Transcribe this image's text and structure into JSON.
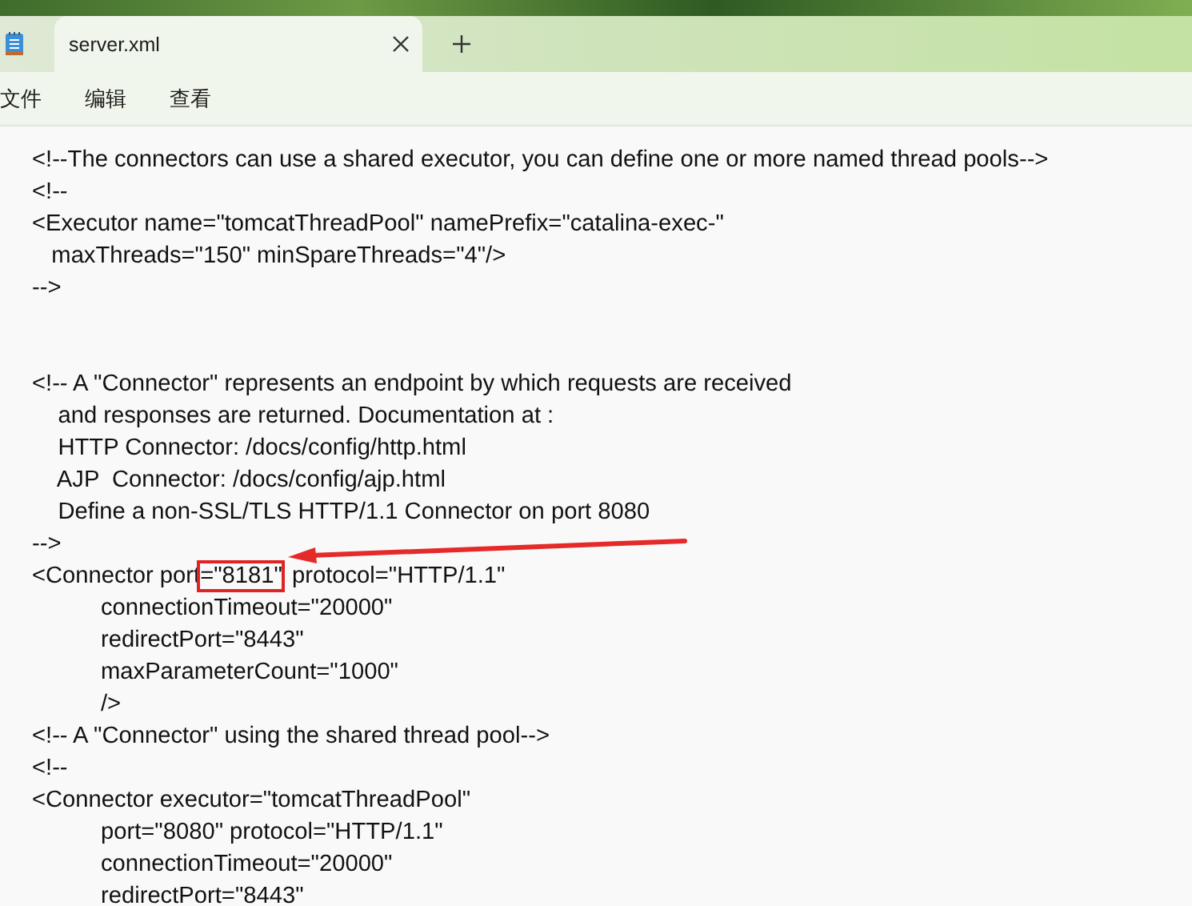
{
  "tabs": [
    {
      "label": "server.xml",
      "selected": true
    }
  ],
  "menu": [
    "文件",
    "编辑",
    "查看"
  ],
  "lines": [
    {
      "kind": "code",
      "text": "<!--The connectors can use a shared executor, you can define one or more named thread pools-->"
    },
    {
      "kind": "code",
      "text": "<!--"
    },
    {
      "kind": "code",
      "text": "<Executor name=\"tomcatThreadPool\" namePrefix=\"catalina-exec-\""
    },
    {
      "kind": "code",
      "text": "   maxThreads=\"150\" minSpareThreads=\"4\"/>"
    },
    {
      "kind": "code",
      "text": "-->"
    },
    {
      "kind": "blank"
    },
    {
      "kind": "blank"
    },
    {
      "kind": "code",
      "text": "<!-- A \"Connector\" represents an endpoint by which requests are received"
    },
    {
      "kind": "code",
      "text": "    and responses are returned. Documentation at :"
    },
    {
      "kind": "code",
      "text": "    HTTP Connector: /docs/config/http.html"
    },
    {
      "kind": "code",
      "text": "    AJP  Connector: /docs/config/ajp.html"
    },
    {
      "kind": "code",
      "text": "    Define a non-SSL/TLS HTTP/1.1 Connector on port 8080"
    },
    {
      "kind": "code",
      "text": "-->"
    },
    {
      "kind": "marked",
      "before": "<Connector port",
      "mark": "=\"8181\"",
      "after": " protocol=\"HTTP/1.1\""
    },
    {
      "kind": "code",
      "text": "\tconnectionTimeout=\"20000\""
    },
    {
      "kind": "code",
      "text": "\tredirectPort=\"8443\""
    },
    {
      "kind": "code",
      "text": "\tmaxParameterCount=\"1000\""
    },
    {
      "kind": "code",
      "text": "\t/>"
    },
    {
      "kind": "code",
      "text": "<!-- A \"Connector\" using the shared thread pool-->"
    },
    {
      "kind": "code",
      "text": "<!--"
    },
    {
      "kind": "code",
      "text": "<Connector executor=\"tomcatThreadPool\""
    },
    {
      "kind": "code",
      "text": "\tport=\"8080\" protocol=\"HTTP/1.1\""
    },
    {
      "kind": "code",
      "text": "\tconnectionTimeout=\"20000\""
    },
    {
      "kind": "code",
      "text": "\tredirectPort=\"8443\""
    }
  ]
}
